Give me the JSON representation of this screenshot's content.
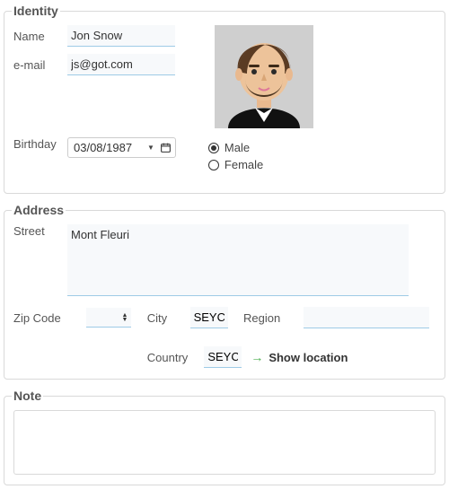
{
  "identity": {
    "legend": "Identity",
    "labels": {
      "name": "Name",
      "email": "e-mail",
      "birthday": "Birthday"
    },
    "name": "Jon Snow",
    "email": "js@got.com",
    "birthday": "03/08/1987",
    "gender": {
      "male_label": "Male",
      "female_label": "Female",
      "selected": "male"
    }
  },
  "address": {
    "legend": "Address",
    "labels": {
      "street": "Street",
      "zip": "Zip Code",
      "city": "City",
      "region": "Region",
      "country": "Country"
    },
    "street": "Mont Fleuri",
    "zip": "",
    "city": "SEYCH",
    "region": "",
    "country": "SEYCH",
    "show_location_label": "Show location"
  },
  "note": {
    "legend": "Note",
    "text": ""
  }
}
